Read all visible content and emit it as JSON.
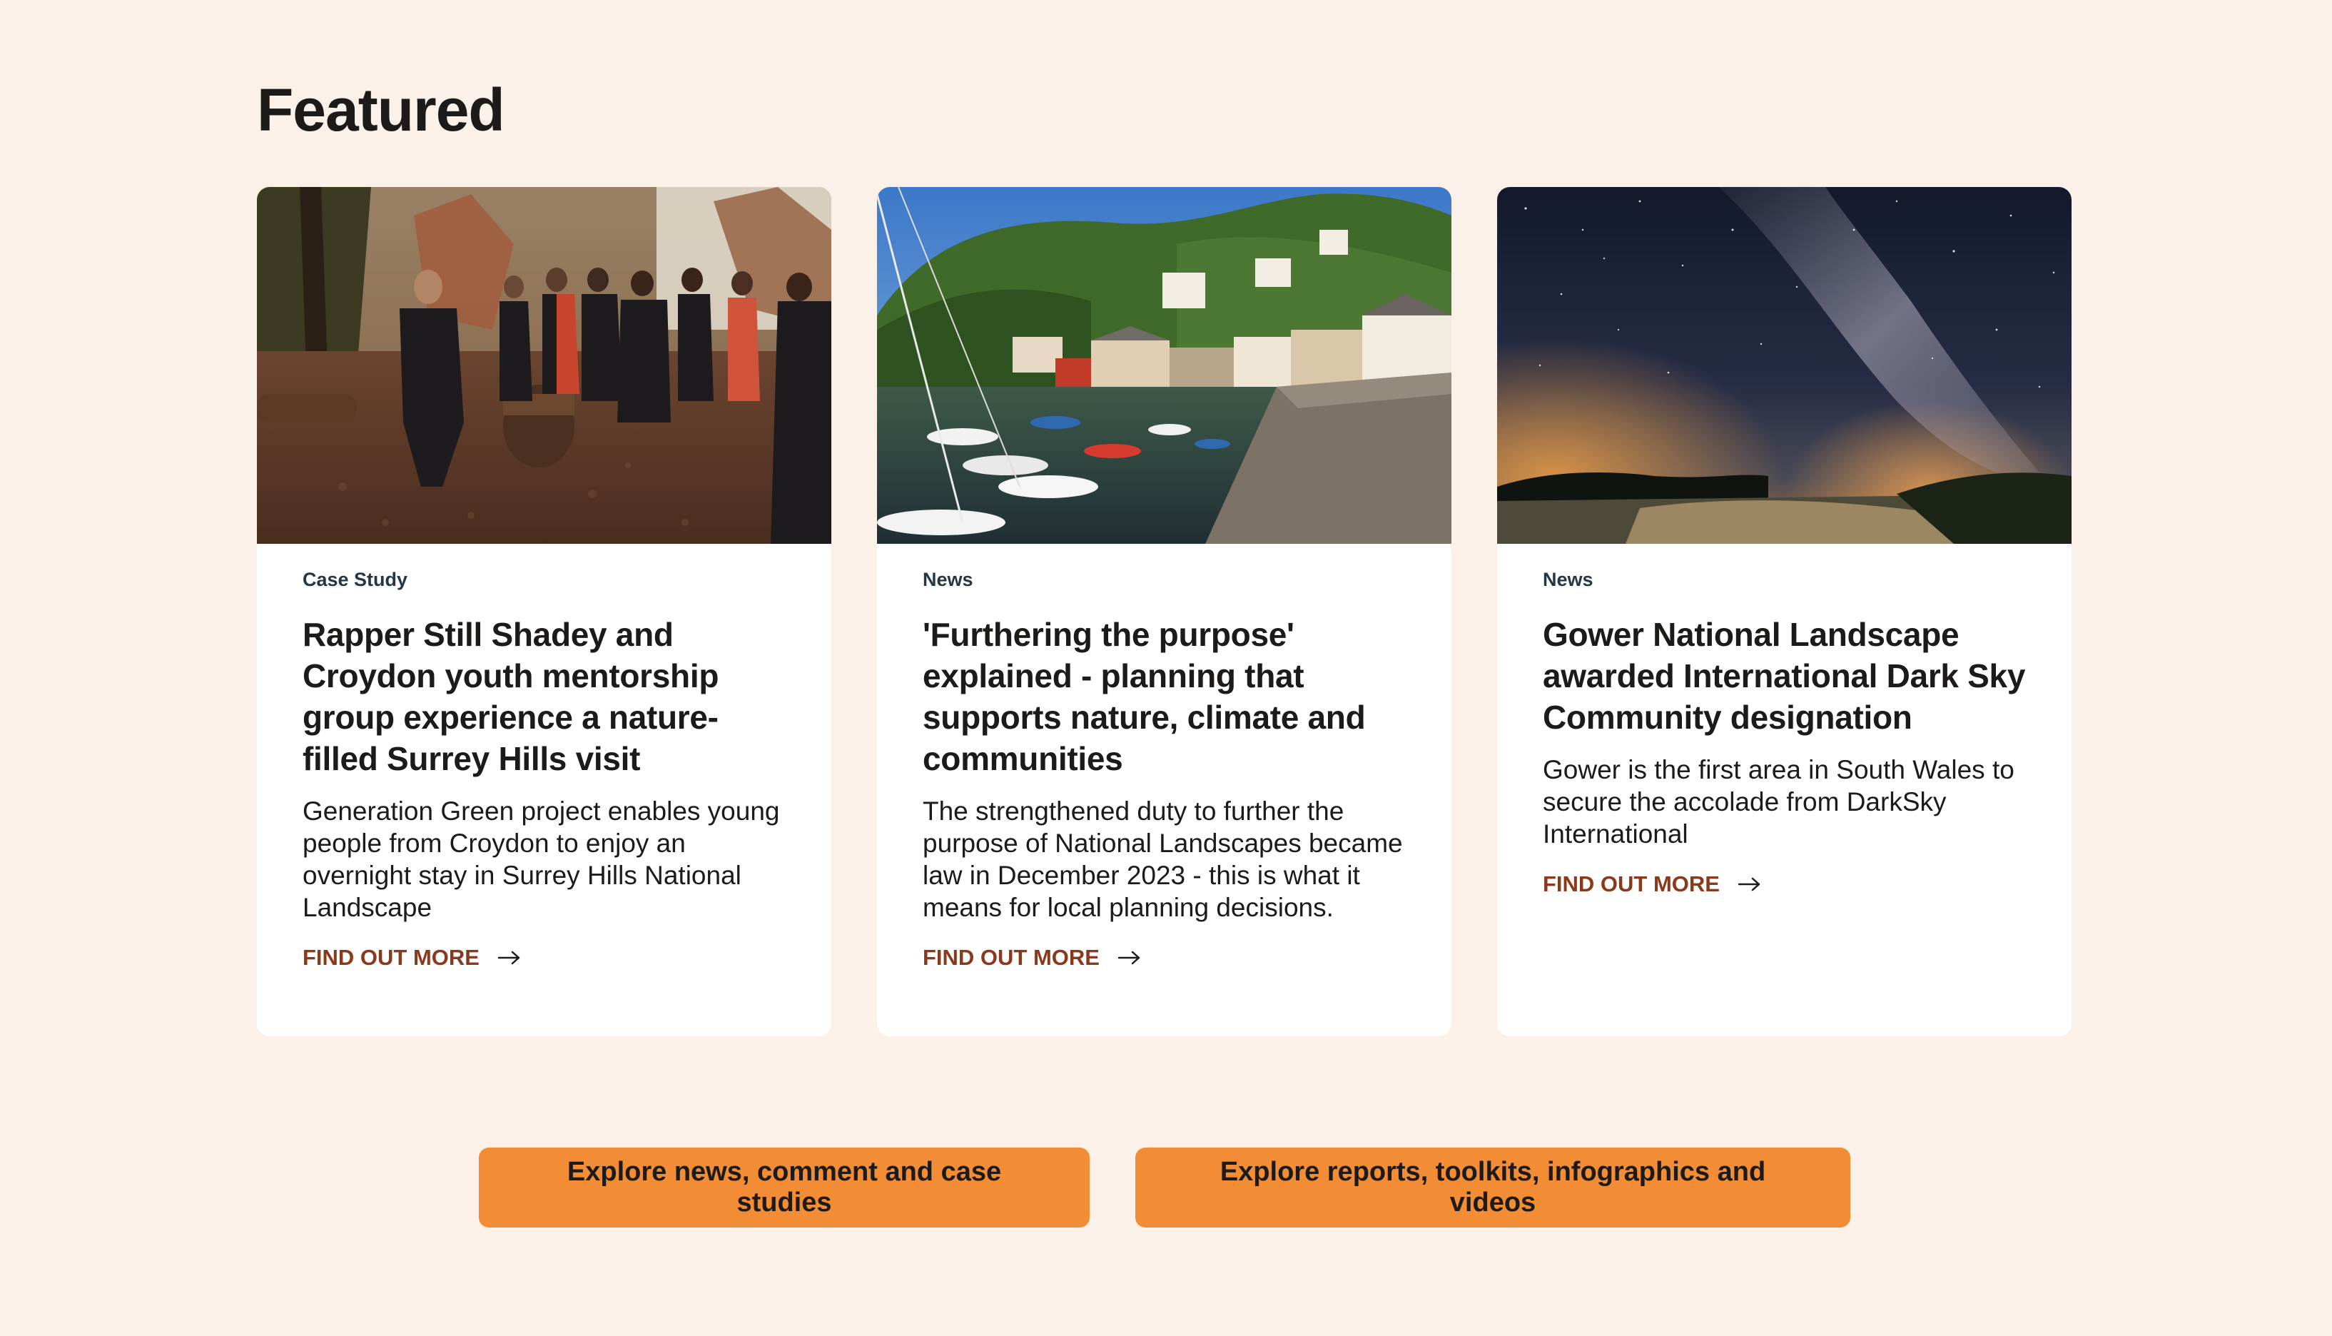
{
  "section": {
    "title": "Featured"
  },
  "cards": [
    {
      "tag": "Case Study",
      "title": "Rapper Still Shadey and Croydon youth mentorship group experience a nature-filled Surrey Hills visit",
      "description": "Generation Green project enables young people from Croydon to enjoy an overnight stay in Surrey Hills National Landscape",
      "link_label": "FIND OUT MORE"
    },
    {
      "tag": "News",
      "title": "'Furthering the purpose' explained - planning that supports nature, climate and communities",
      "description": "The strengthened duty to further the purpose of National Landscapes became law in December 2023 - this is what it means for local planning decisions.",
      "link_label": "FIND OUT MORE"
    },
    {
      "tag": "News",
      "title": "Gower National Landscape awarded International Dark Sky Community designation",
      "description": "Gower is the first area in South Wales to secure the accolade from DarkSky International",
      "link_label": "FIND OUT MORE"
    }
  ],
  "buttons": {
    "news": "Explore news, comment and case studies",
    "reports": "Explore reports, toolkits, infographics and videos"
  },
  "colors": {
    "background": "#fcf1e8",
    "card": "#ffffff",
    "link": "#8a3a1c",
    "tag": "#243746",
    "button": "#f28d35"
  }
}
